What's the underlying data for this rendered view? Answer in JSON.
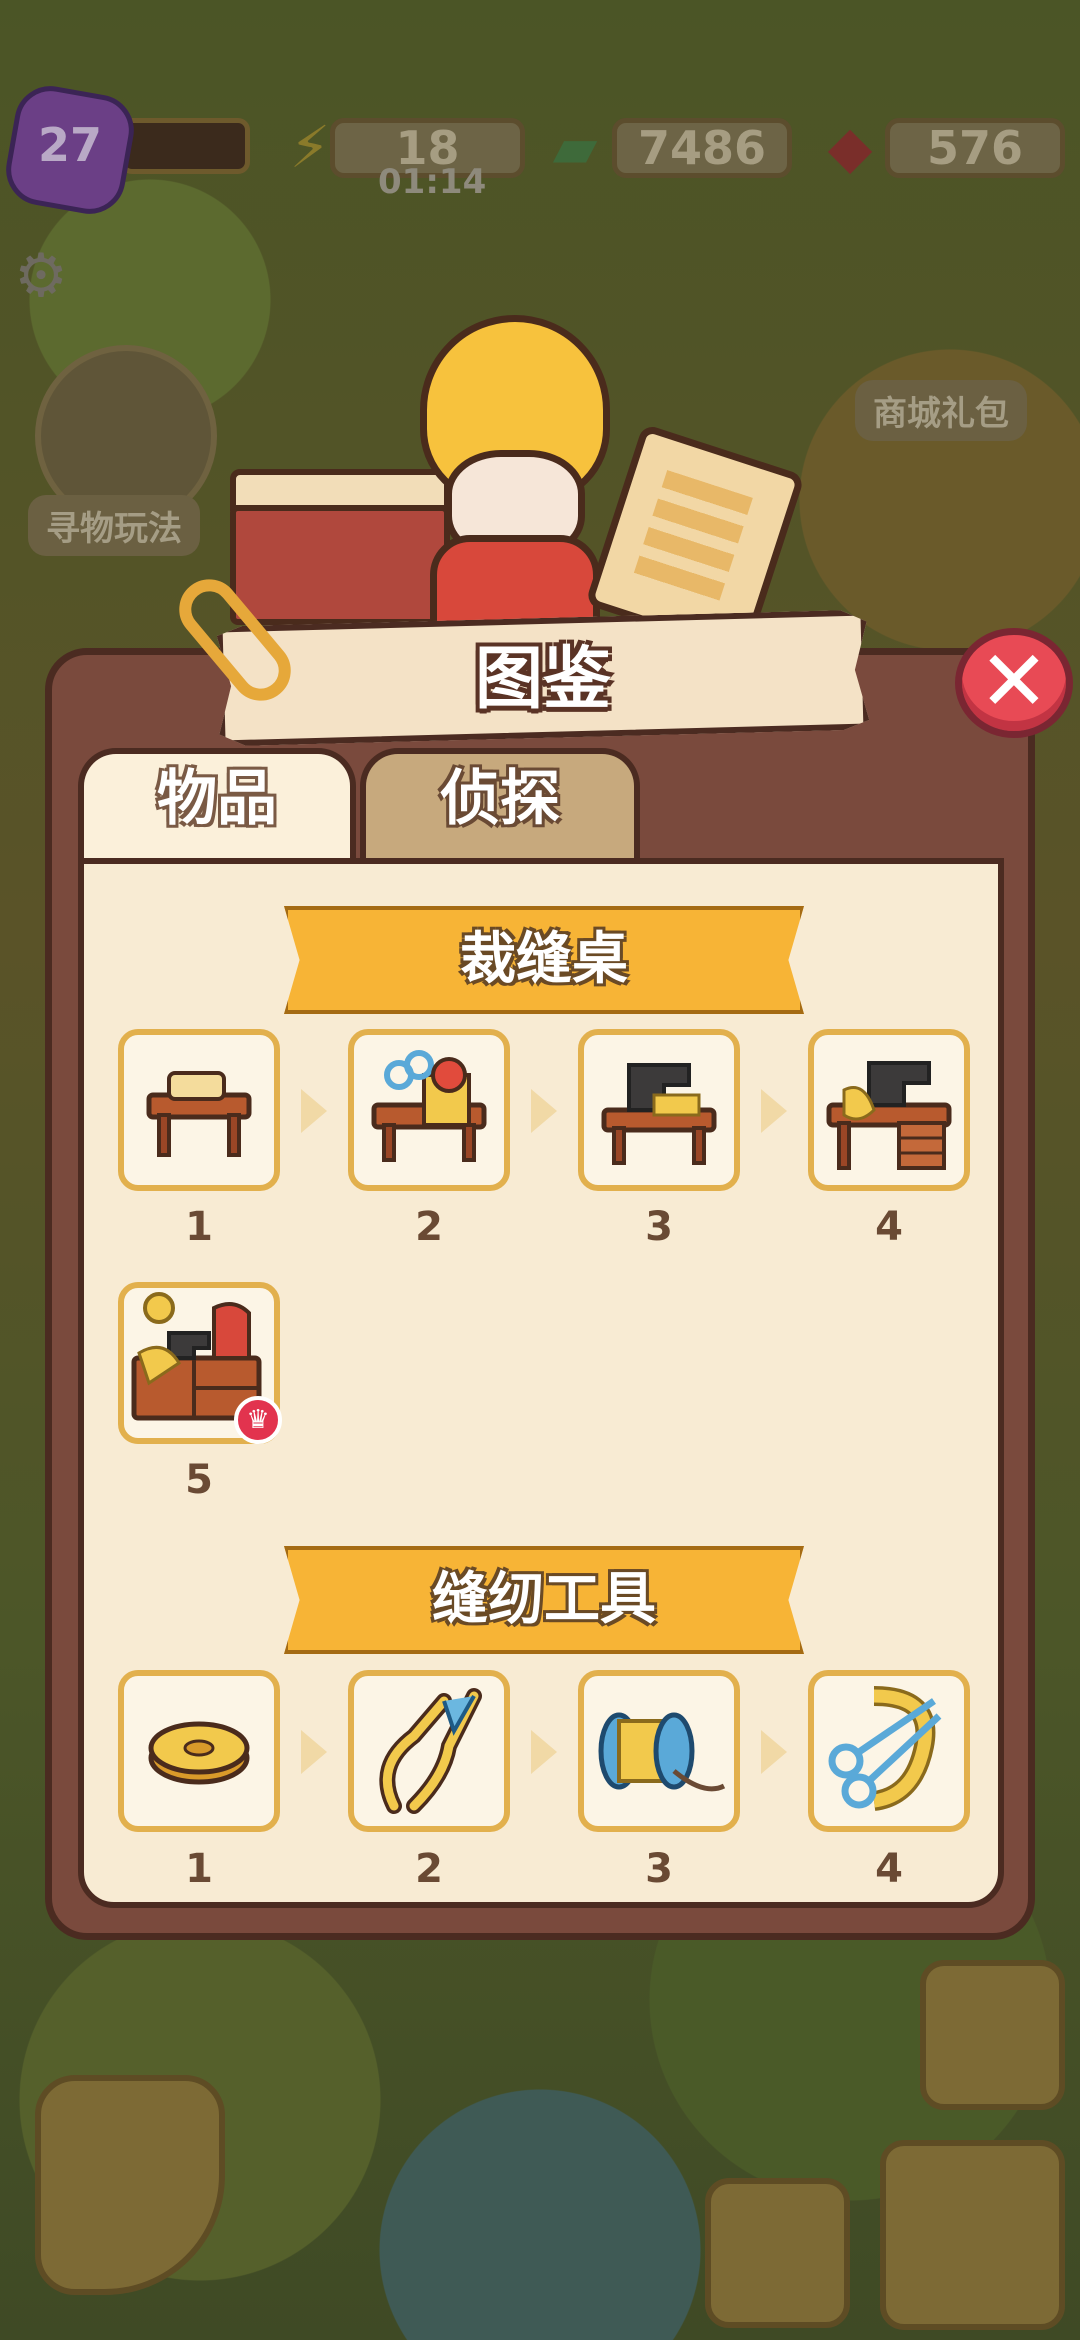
{
  "hud": {
    "level": "27",
    "energy": "18",
    "energy_timer": "01:14",
    "cash": "7486",
    "gems": "576"
  },
  "side": {
    "treasure_hunt_label": "寻物玩法",
    "shop_pack_label": "商城礼包"
  },
  "modal": {
    "title": "图鉴",
    "close_label": "✕",
    "tabs": [
      {
        "label": "物品",
        "active": true
      },
      {
        "label": "侦探",
        "active": false
      }
    ],
    "sections": [
      {
        "title": "裁缝桌",
        "items": [
          {
            "level": "1",
            "icon": "table-with-scroll-icon"
          },
          {
            "level": "2",
            "icon": "table-with-scissors-icon"
          },
          {
            "level": "3",
            "icon": "sewing-machine-table-icon"
          },
          {
            "level": "4",
            "icon": "sewing-desk-icon"
          },
          {
            "level": "5",
            "icon": "tailor-workbench-icon",
            "max_badge": "♛"
          }
        ]
      },
      {
        "title": "缝纫工具",
        "items": [
          {
            "level": "1",
            "icon": "measuring-tape-icon"
          },
          {
            "level": "2",
            "icon": "thread-snips-icon"
          },
          {
            "level": "3",
            "icon": "thread-spool-icon"
          },
          {
            "level": "4",
            "icon": "scissors-and-ribbon-icon"
          }
        ]
      }
    ]
  },
  "colors": {
    "panel": "#7a4a3d",
    "content_bg": "#f8ebd3",
    "banner": "#f7b436",
    "close": "#e84a55",
    "slot_border": "#e2b04d"
  }
}
